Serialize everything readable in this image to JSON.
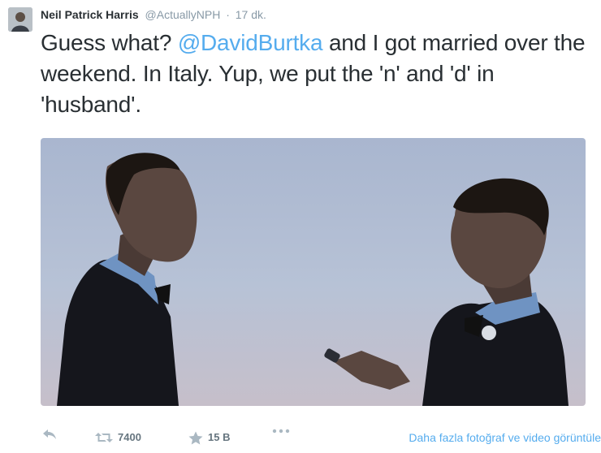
{
  "tweet": {
    "display_name": "Neil Patrick Harris",
    "handle": "@ActuallyNPH",
    "separator": "·",
    "time": "17 dk.",
    "text_before": "Guess what? ",
    "mention": "@DavidBurtka",
    "text_after": " and I got married over the weekend. In Italy. Yup, we put the 'n' and 'd' in 'husband'."
  },
  "actions": {
    "reply_icon": "reply-icon",
    "retweet_icon": "retweet-icon",
    "retweet_count": "7400",
    "favorite_icon": "star-icon",
    "favorite_count": "15 B",
    "more_icon": "more-dots-icon",
    "view_more_label": "Daha fazla fotoğraf ve video görüntüle"
  },
  "colors": {
    "link": "#55acee",
    "muted": "#8899a6",
    "text": "#292f33"
  }
}
